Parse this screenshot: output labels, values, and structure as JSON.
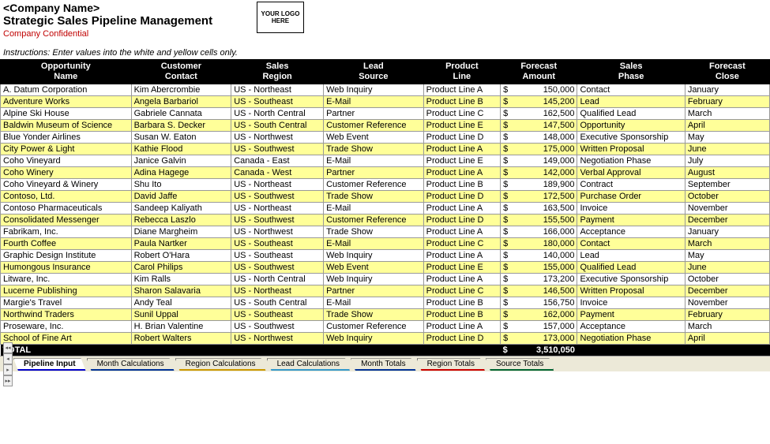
{
  "header": {
    "company_name": "<Company Name>",
    "title": "Strategic Sales Pipeline Management",
    "confidential": "Company Confidential",
    "logo_text": "YOUR LOGO HERE",
    "instructions": "Instructions: Enter values into the white and yellow cells only."
  },
  "columns": [
    "Opportunity Name",
    "Customer Contact",
    "Sales Region",
    "Lead Source",
    "Product Line",
    "Forecast Amount",
    "Sales Phase",
    "Forecast Close"
  ],
  "rows": [
    {
      "opp": "A. Datum Corporation",
      "contact": "Kim Abercrombie",
      "region": "US - Northeast",
      "lead": "Web Inquiry",
      "product": "Product Line A",
      "amount": "150,000",
      "phase": "Contact",
      "close": "January"
    },
    {
      "opp": "Adventure Works",
      "contact": "Angela Barbariol",
      "region": "US - Southeast",
      "lead": "E-Mail",
      "product": "Product Line B",
      "amount": "145,200",
      "phase": "Lead",
      "close": "February"
    },
    {
      "opp": "Alpine Ski House",
      "contact": "Gabriele Cannata",
      "region": "US - North Central",
      "lead": "Partner",
      "product": "Product Line C",
      "amount": "162,500",
      "phase": "Qualified Lead",
      "close": "March"
    },
    {
      "opp": "Baldwin Museum of Science",
      "contact": "Barbara S. Decker",
      "region": "US - South Central",
      "lead": "Customer Reference",
      "product": "Product Line E",
      "amount": "147,500",
      "phase": "Opportunity",
      "close": "April"
    },
    {
      "opp": "Blue Yonder Airlines",
      "contact": "Susan W. Eaton",
      "region": "US - Northwest",
      "lead": "Web Event",
      "product": "Product Line D",
      "amount": "148,000",
      "phase": "Executive Sponsorship",
      "close": "May"
    },
    {
      "opp": "City Power & Light",
      "contact": "Kathie Flood",
      "region": "US - Southwest",
      "lead": "Trade Show",
      "product": "Product Line A",
      "amount": "175,000",
      "phase": "Written Proposal",
      "close": "June"
    },
    {
      "opp": "Coho Vineyard",
      "contact": "Janice Galvin",
      "region": "Canada - East",
      "lead": "E-Mail",
      "product": "Product Line E",
      "amount": "149,000",
      "phase": "Negotiation Phase",
      "close": "July"
    },
    {
      "opp": "Coho Winery",
      "contact": "Adina Hagege",
      "region": "Canada - West",
      "lead": "Partner",
      "product": "Product Line A",
      "amount": "142,000",
      "phase": "Verbal Approval",
      "close": "August"
    },
    {
      "opp": "Coho Vineyard & Winery",
      "contact": "Shu Ito",
      "region": "US - Northeast",
      "lead": "Customer Reference",
      "product": "Product Line B",
      "amount": "189,900",
      "phase": "Contract",
      "close": "September"
    },
    {
      "opp": "Contoso, Ltd.",
      "contact": "David Jaffe",
      "region": "US - Southwest",
      "lead": "Trade Show",
      "product": "Product Line D",
      "amount": "172,500",
      "phase": "Purchase Order",
      "close": "October"
    },
    {
      "opp": "Contoso Pharmaceuticals",
      "contact": "Sandeep Kaliyath",
      "region": "US - Northeast",
      "lead": "E-Mail",
      "product": "Product Line A",
      "amount": "163,500",
      "phase": "Invoice",
      "close": "November"
    },
    {
      "opp": "Consolidated Messenger",
      "contact": "Rebecca Laszlo",
      "region": "US - Southwest",
      "lead": "Customer Reference",
      "product": "Product Line D",
      "amount": "155,500",
      "phase": "Payment",
      "close": "December"
    },
    {
      "opp": "Fabrikam, Inc.",
      "contact": "Diane Margheim",
      "region": "US - Northwest",
      "lead": "Trade Show",
      "product": "Product Line A",
      "amount": "166,000",
      "phase": "Acceptance",
      "close": "January"
    },
    {
      "opp": "Fourth Coffee",
      "contact": "Paula Nartker",
      "region": "US - Southeast",
      "lead": "E-Mail",
      "product": "Product Line C",
      "amount": "180,000",
      "phase": "Contact",
      "close": "March"
    },
    {
      "opp": "Graphic Design Institute",
      "contact": "Robert O'Hara",
      "region": "US - Southeast",
      "lead": "Web Inquiry",
      "product": "Product Line A",
      "amount": "140,000",
      "phase": "Lead",
      "close": "May"
    },
    {
      "opp": "Humongous Insurance",
      "contact": "Carol Philips",
      "region": "US - Southwest",
      "lead": "Web Event",
      "product": "Product Line E",
      "amount": "155,000",
      "phase": "Qualified Lead",
      "close": "June"
    },
    {
      "opp": "Litware, Inc.",
      "contact": "Kim Ralls",
      "region": "US - North Central",
      "lead": "Web Inquiry",
      "product": "Product Line A",
      "amount": "173,200",
      "phase": "Executive Sponsorship",
      "close": "October"
    },
    {
      "opp": "Lucerne Publishing",
      "contact": "Sharon Salavaria",
      "region": "US - Northeast",
      "lead": "Partner",
      "product": "Product Line C",
      "amount": "146,500",
      "phase": "Written Proposal",
      "close": "December"
    },
    {
      "opp": "Margie's Travel",
      "contact": "Andy Teal",
      "region": "US - South Central",
      "lead": "E-Mail",
      "product": "Product Line B",
      "amount": "156,750",
      "phase": "Invoice",
      "close": "November"
    },
    {
      "opp": "Northwind Traders",
      "contact": "Sunil Uppal",
      "region": "US - Southeast",
      "lead": "Trade Show",
      "product": "Product Line B",
      "amount": "162,000",
      "phase": "Payment",
      "close": "February"
    },
    {
      "opp": "Proseware, Inc.",
      "contact": "H. Brian Valentine",
      "region": "US - Southwest",
      "lead": "Customer Reference",
      "product": "Product Line A",
      "amount": "157,000",
      "phase": "Acceptance",
      "close": "March"
    },
    {
      "opp": "School of Fine Art",
      "contact": "Robert Walters",
      "region": "US - Northwest",
      "lead": "Web Inquiry",
      "product": "Product Line D",
      "amount": "173,000",
      "phase": "Negotiation Phase",
      "close": "April"
    }
  ],
  "total": {
    "label": "TOTAL",
    "amount": "3,510,050"
  },
  "col_widths": [
    "17%",
    "13%",
    "12%",
    "13%",
    "10%",
    "10%",
    "14%",
    "11%"
  ],
  "tabs": {
    "nav": [
      "◂◂",
      "◂",
      "▸",
      "▸▸"
    ],
    "items": [
      {
        "label": "Pipeline Input",
        "cls": "active"
      },
      {
        "label": "Month Calculations",
        "cls": "c-blue"
      },
      {
        "label": "Region Calculations",
        "cls": "c-yellow"
      },
      {
        "label": "Lead Calculations",
        "cls": "c-cyan"
      },
      {
        "label": "Month Totals",
        "cls": "c-blue2"
      },
      {
        "label": "Region Totals",
        "cls": "c-red"
      },
      {
        "label": "Source Totals",
        "cls": "c-green"
      }
    ]
  }
}
